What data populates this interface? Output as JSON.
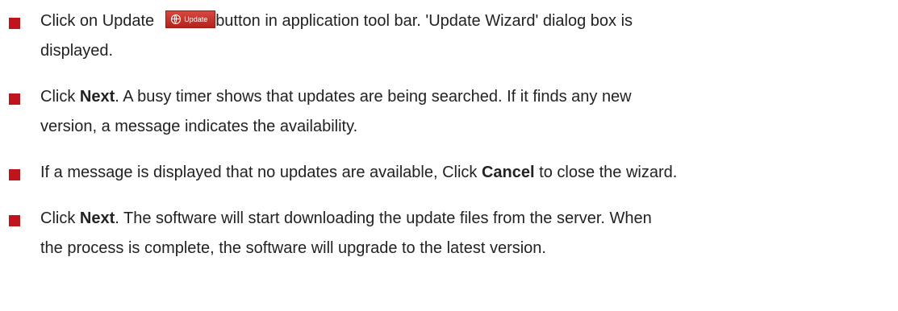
{
  "items": [
    {
      "line1_before": "Click on Update",
      "update_button_label": "Update",
      "line1_after": "button in application tool bar. 'Update Wizard' dialog box is",
      "line2": "displayed."
    },
    {
      "click": "Click",
      "bold": "Next",
      "line1_rest": ". A busy timer shows that updates are being searched. If it finds any new",
      "line2": "version, a message indicates the availability."
    },
    {
      "before": "If a message is displayed that no updates are available, Click",
      "bold": "Cancel",
      "after": "to close the wizard."
    },
    {
      "click": "Click",
      "bold": "Next",
      "line1_rest": ". The software will start downloading the update files from the server. When",
      "line2": "the process is complete, the software will upgrade to the latest version."
    }
  ],
  "colors": {
    "bullet": "#c0141c",
    "text": "#222222",
    "update_button": "#c4302a"
  },
  "icons": {
    "update_button_icon": "globe-icon"
  }
}
